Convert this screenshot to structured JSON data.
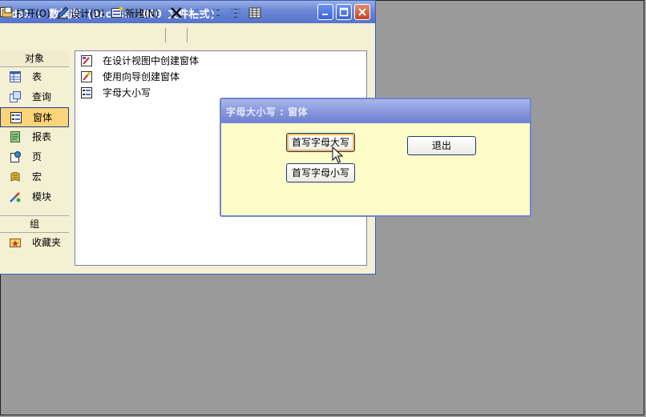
{
  "db_window": {
    "title": "db1 : 数据库 (Access 2000 文件格式)",
    "toolbar": {
      "open": "打开(O)",
      "design": "设计(D)",
      "new": "新建(N)"
    },
    "objects_header": "对象",
    "objects": [
      {
        "label": "表",
        "icon": "table-icon"
      },
      {
        "label": "查询",
        "icon": "query-icon"
      },
      {
        "label": "窗体",
        "icon": "form-icon",
        "selected": true
      },
      {
        "label": "报表",
        "icon": "report-icon"
      },
      {
        "label": "页",
        "icon": "page-icon"
      },
      {
        "label": "宏",
        "icon": "macro-icon"
      },
      {
        "label": "模块",
        "icon": "module-icon"
      }
    ],
    "groups_header": "组",
    "groups": [
      {
        "label": "收藏夹",
        "icon": "favorites-icon"
      }
    ],
    "list_items": [
      {
        "label": "在设计视图中创建窗体",
        "icon": "design-wizard-icon"
      },
      {
        "label": "使用向导创建窗体",
        "icon": "wizard-icon"
      },
      {
        "label": "字母大小写",
        "icon": "form-icon"
      }
    ]
  },
  "form_window": {
    "title": "字母大小写 : 窗体",
    "buttons": {
      "upper": "首写字母大写",
      "lower": "首写字母小写",
      "exit": "退出"
    }
  },
  "colors": {
    "desktop": "#9a9a9a",
    "form_bg": "#fefcc8",
    "selected_object": "#fbd47a",
    "title_blue": "#5573c9"
  }
}
